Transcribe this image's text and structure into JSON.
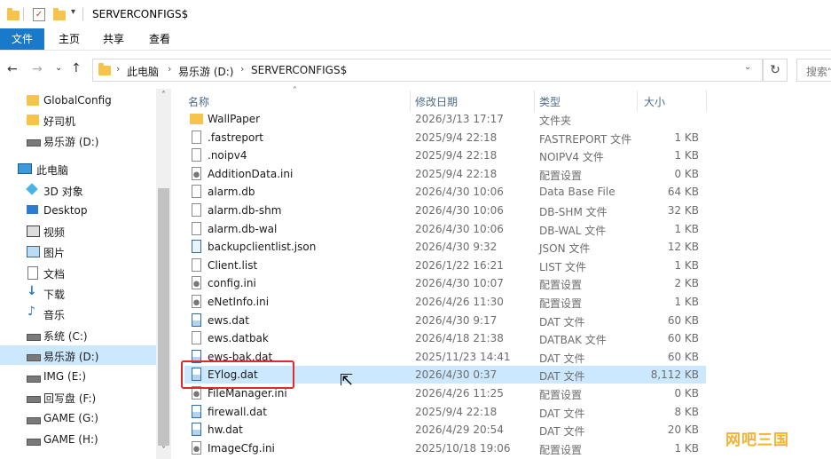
{
  "window": {
    "title": "SERVERCONFIGS$"
  },
  "ribbon": {
    "tabs": [
      "文件",
      "主页",
      "共享",
      "查看"
    ]
  },
  "address": {
    "crumbs": [
      "此电脑",
      "易乐游 (D:)",
      "SERVERCONFIGS$"
    ],
    "search_placeholder": "搜索“"
  },
  "sidebar": {
    "items": [
      {
        "label": "GlobalConfig",
        "icon": "folder-icon"
      },
      {
        "label": "好司机",
        "icon": "folder-icon"
      },
      {
        "label": "易乐游 (D:)",
        "icon": "drive-icon"
      },
      {
        "label": "此电脑",
        "icon": "computer-icon"
      },
      {
        "label": "3D 对象",
        "icon": "3d-objects-icon"
      },
      {
        "label": "Desktop",
        "icon": "desktop-icon"
      },
      {
        "label": "视频",
        "icon": "video-icon"
      },
      {
        "label": "图片",
        "icon": "pictures-icon"
      },
      {
        "label": "文档",
        "icon": "documents-icon"
      },
      {
        "label": "下载",
        "icon": "download-icon"
      },
      {
        "label": "音乐",
        "icon": "music-icon"
      },
      {
        "label": "系统 (C:)",
        "icon": "drive-icon"
      },
      {
        "label": "易乐游 (D:)",
        "icon": "drive-icon"
      },
      {
        "label": "IMG (E:)",
        "icon": "drive-icon"
      },
      {
        "label": "回写盘 (F:)",
        "icon": "drive-icon"
      },
      {
        "label": "GAME (G:)",
        "icon": "drive-icon"
      },
      {
        "label": "GAME (H:)",
        "icon": "drive-icon"
      }
    ]
  },
  "columns": {
    "name": "名称",
    "date": "修改日期",
    "type": "类型",
    "size": "大小"
  },
  "files": [
    {
      "name": "WallPaper",
      "date": "2026/3/13 17:17",
      "type": "文件夹",
      "size": "",
      "icon": "folder"
    },
    {
      "name": ".fastreport",
      "date": "2025/9/4 22:18",
      "type": "FASTREPORT 文件",
      "size": "1 KB",
      "icon": "file"
    },
    {
      "name": ".noipv4",
      "date": "2025/9/4 22:18",
      "type": "NOIPV4 文件",
      "size": "1 KB",
      "icon": "file"
    },
    {
      "name": "AdditionData.ini",
      "date": "2025/9/4 22:18",
      "type": "配置设置",
      "size": "0 KB",
      "icon": "ini"
    },
    {
      "name": "alarm.db",
      "date": "2026/4/30 10:06",
      "type": "Data Base File",
      "size": "64 KB",
      "icon": "file"
    },
    {
      "name": "alarm.db-shm",
      "date": "2026/4/30 10:06",
      "type": "DB-SHM 文件",
      "size": "32 KB",
      "icon": "file"
    },
    {
      "name": "alarm.db-wal",
      "date": "2026/4/30 10:06",
      "type": "DB-WAL 文件",
      "size": "1 KB",
      "icon": "file"
    },
    {
      "name": "backupclientlist.json",
      "date": "2026/4/30 9:32",
      "type": "JSON 文件",
      "size": "12 KB",
      "icon": "json"
    },
    {
      "name": "Client.list",
      "date": "2026/1/22 16:21",
      "type": "LIST 文件",
      "size": "1 KB",
      "icon": "file"
    },
    {
      "name": "config.ini",
      "date": "2026/4/30 10:07",
      "type": "配置设置",
      "size": "2 KB",
      "icon": "ini"
    },
    {
      "name": "eNetInfo.ini",
      "date": "2026/4/26 11:30",
      "type": "配置设置",
      "size": "1 KB",
      "icon": "ini"
    },
    {
      "name": "ews.dat",
      "date": "2026/4/30 9:17",
      "type": "DAT 文件",
      "size": "60 KB",
      "icon": "dat"
    },
    {
      "name": "ews.datbak",
      "date": "2026/4/18 21:38",
      "type": "DATBAK 文件",
      "size": "60 KB",
      "icon": "file"
    },
    {
      "name": "ews-bak.dat",
      "date": "2025/11/23 14:41",
      "type": "DAT 文件",
      "size": "60 KB",
      "icon": "dat"
    },
    {
      "name": "EYlog.dat",
      "date": "2026/4/30 0:37",
      "type": "DAT 文件",
      "size": "8,112 KB",
      "icon": "dat"
    },
    {
      "name": "FileManager.ini",
      "date": "2026/4/26 11:25",
      "type": "配置设置",
      "size": "0 KB",
      "icon": "ini"
    },
    {
      "name": "firewall.dat",
      "date": "2025/9/4 22:18",
      "type": "DAT 文件",
      "size": "8 KB",
      "icon": "dat"
    },
    {
      "name": "hw.dat",
      "date": "2026/4/29 20:54",
      "type": "DAT 文件",
      "size": "20 KB",
      "icon": "dat"
    },
    {
      "name": "ImageCfg.ini",
      "date": "2025/10/18 19:06",
      "type": "配置设置",
      "size": "1 KB",
      "icon": "ini"
    }
  ],
  "selected_index": 14,
  "sidebar_selected_index": 12,
  "watermark": "网吧三国",
  "colors": {
    "accent": "#1979ca",
    "selection": "#cce8ff",
    "highlight_box": "#e02a2a",
    "folder": "#f6c44a"
  }
}
